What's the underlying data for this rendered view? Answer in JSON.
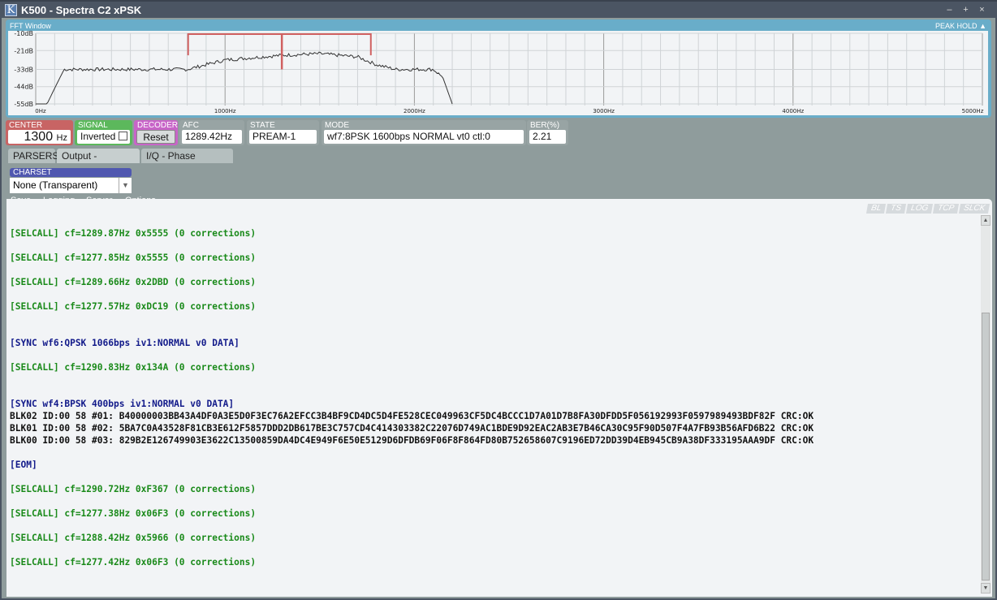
{
  "window": {
    "title": "K500 - Spectra C2 xPSK",
    "logo": "K",
    "minimize": "–",
    "maximize": "+",
    "close": "×"
  },
  "fft": {
    "label": "FFT Window",
    "peak_hold": "PEAK HOLD",
    "y_ticks": [
      "-10dB",
      "-21dB",
      "-33dB",
      "-44dB",
      "-55dB"
    ],
    "x_ticks": [
      "0Hz",
      "1000Hz",
      "2000Hz",
      "3000Hz",
      "4000Hz",
      "5000Hz"
    ],
    "x_range_hz": [
      0,
      5000
    ],
    "y_range_db": [
      -55,
      -10
    ],
    "spectrum": [
      [
        0,
        -55
      ],
      [
        60,
        -55
      ],
      [
        100,
        -45
      ],
      [
        150,
        -33
      ],
      [
        800,
        -33
      ],
      [
        1000,
        -27
      ],
      [
        1200,
        -25
      ],
      [
        1300,
        -24
      ],
      [
        1500,
        -23
      ],
      [
        1700,
        -25
      ],
      [
        1800,
        -30
      ],
      [
        1900,
        -33
      ],
      [
        2100,
        -33
      ],
      [
        2150,
        -38
      ],
      [
        2200,
        -55
      ]
    ],
    "marker_center_hz": 1300,
    "marker_band_hz": [
      805,
      1770
    ],
    "marker_color": "#d06060",
    "trace_color": "#333333"
  },
  "status": {
    "center": {
      "label": "CENTER",
      "value": "1300",
      "unit": "Hz",
      "color": "#c86464"
    },
    "signal": {
      "label": "SIGNAL",
      "value": "Inverted",
      "checked": false,
      "color": "#5cb85c"
    },
    "decoder": {
      "label": "DECODER",
      "button": "Reset",
      "color": "#c864c8"
    },
    "afc": {
      "label": "AFC",
      "value": "1289.42Hz"
    },
    "state": {
      "label": "STATE",
      "value": "PREAM-1"
    },
    "mode": {
      "label": "MODE",
      "value": "wf7:8PSK 1600bps NORMAL vt0 ctl:0"
    },
    "ber": {
      "label": "BER(%)",
      "value": "2.21"
    }
  },
  "tabs": [
    {
      "label": "PARSERS"
    },
    {
      "label": "Output - ASCII",
      "active": true
    },
    {
      "label": "I/Q - Phase plane"
    }
  ],
  "charset": {
    "label": "CHARSET",
    "value": "None (Transparent)"
  },
  "menu": [
    "Save",
    "Logging",
    "Server",
    "Options"
  ],
  "flags": [
    "BL",
    "TS",
    "LOG",
    "TCP",
    "SLCK"
  ],
  "output": [
    {
      "t": "[SELCALL] cf=1289.87Hz 0x5555 (0 corrections)",
      "c": "green"
    },
    {
      "t": ""
    },
    {
      "t": "[SELCALL] cf=1277.85Hz 0x5555 (0 corrections)",
      "c": "green"
    },
    {
      "t": ""
    },
    {
      "t": "[SELCALL] cf=1289.66Hz 0x2DBD (0 corrections)",
      "c": "green"
    },
    {
      "t": ""
    },
    {
      "t": "[SELCALL] cf=1277.57Hz 0xDC19 (0 corrections)",
      "c": "green"
    },
    {
      "t": ""
    },
    {
      "t": ""
    },
    {
      "t": "[SYNC wf6:QPSK 1066bps iv1:NORMAL v0 DATA]",
      "c": "navy"
    },
    {
      "t": ""
    },
    {
      "t": "[SELCALL] cf=1290.83Hz 0x134A (0 corrections)",
      "c": "green"
    },
    {
      "t": ""
    },
    {
      "t": ""
    },
    {
      "t": "[SYNC wf4:BPSK 400bps iv1:NORMAL v0 DATA]",
      "c": "navy"
    },
    {
      "t": "BLK02 ID:00 58 #01: B40000003BB43A4DF0A3E5D0F3EC76A2EFCC3B4BF9CD4DC5D4FE528CEC049963CF5DC4BCCC1D7A01D7B8FA30DFDD5F056192993F0597989493BDF82F CRC:OK",
      "c": "black"
    },
    {
      "t": "BLK01 ID:00 58 #02: 5BA7C0A43528F81CB3E612F5857DDD2DB617BE3C757CD4C414303382C22076D749AC1BDE9D92EAC2AB3E7B46CA30C95F90D507F4A7FB93B56AFD6B22 CRC:OK",
      "c": "black"
    },
    {
      "t": "BLK00 ID:00 58 #03: 829B2E126749903E3622C13500859DA4DC4E949F6E50E5129D6DFDB69F06F8F864FD80B752658607C9196ED72DD39D4EB945CB9A38DF333195AAA9DF CRC:OK",
      "c": "black"
    },
    {
      "t": ""
    },
    {
      "t": "[EOM]",
      "c": "navy"
    },
    {
      "t": ""
    },
    {
      "t": "[SELCALL] cf=1290.72Hz 0xF367 (0 corrections)",
      "c": "green"
    },
    {
      "t": ""
    },
    {
      "t": "[SELCALL] cf=1277.38Hz 0x06F3 (0 corrections)",
      "c": "green"
    },
    {
      "t": ""
    },
    {
      "t": "[SELCALL] cf=1288.42Hz 0x5966 (0 corrections)",
      "c": "green"
    },
    {
      "t": ""
    },
    {
      "t": "[SELCALL] cf=1277.42Hz 0x06F3 (0 corrections)",
      "c": "green"
    }
  ]
}
